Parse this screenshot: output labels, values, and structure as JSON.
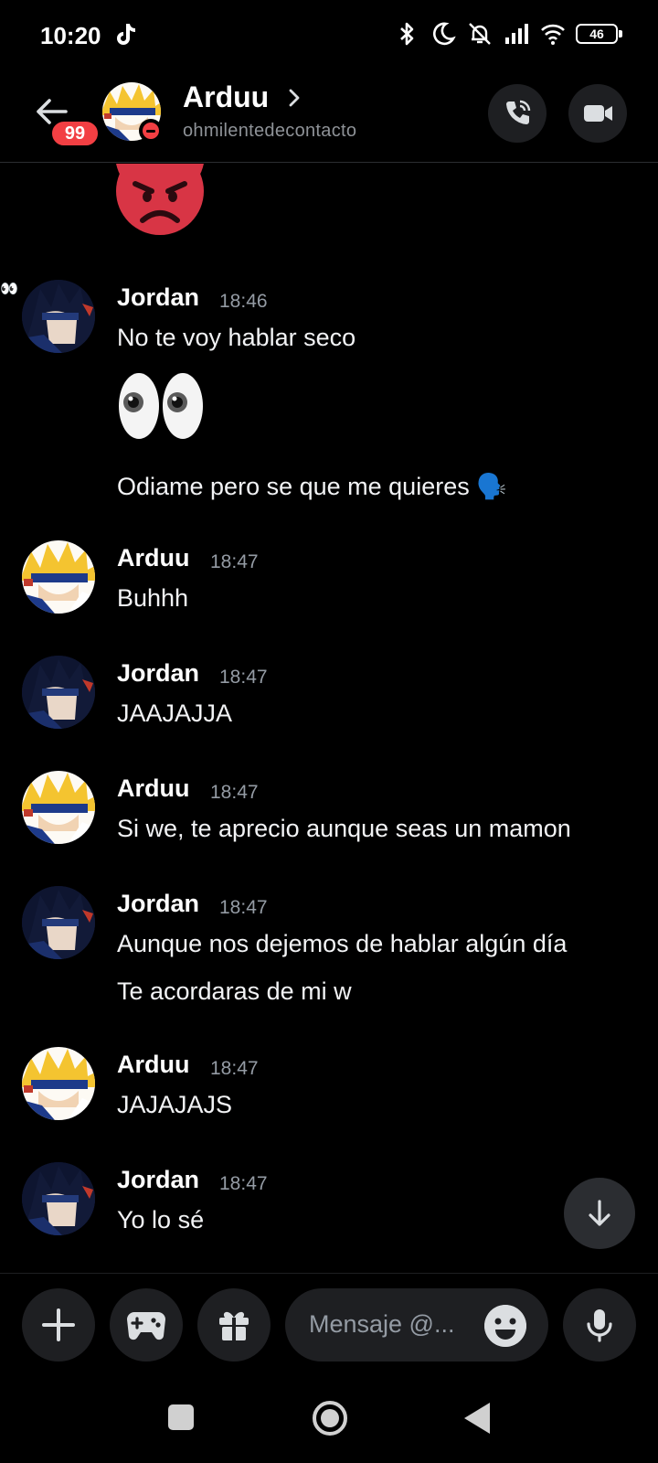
{
  "status_bar": {
    "time": "10:20",
    "battery": "46",
    "icons": [
      "tiktok-icon",
      "bluetooth-icon",
      "moon-icon",
      "mute-icon",
      "signal-icon",
      "wifi-icon",
      "battery-icon"
    ]
  },
  "header": {
    "unread_count": "99",
    "name": "Arduu",
    "username": "ohmilentedecontacto",
    "status": "do-not-disturb",
    "actions": [
      "phone-call-icon",
      "video-camera-icon"
    ]
  },
  "messages": [
    {
      "author": "Jordan",
      "time": "18:46",
      "lines": [
        "No te voy hablar seco",
        "👀",
        "Odiame pero se que me quieres 🗣️"
      ]
    },
    {
      "author": "Arduu",
      "time": "18:47",
      "lines": [
        "Buhhh"
      ]
    },
    {
      "author": "Jordan",
      "time": "18:47",
      "lines": [
        "JAAJAJJA"
      ]
    },
    {
      "author": "Arduu",
      "time": "18:47",
      "lines": [
        "Si we, te aprecio aunque seas un mamon"
      ]
    },
    {
      "author": "Jordan",
      "time": "18:47",
      "lines": [
        "Aunque nos dejemos de hablar algún día",
        "Te acordaras de mi w"
      ]
    },
    {
      "author": "Arduu",
      "time": "18:47",
      "lines": [
        "JAJAJAJS"
      ]
    },
    {
      "author": "Jordan",
      "time": "18:47",
      "lines": [
        "Yo lo sé"
      ]
    }
  ],
  "composer": {
    "placeholder": "Mensaje @...",
    "buttons": [
      "plus-icon",
      "gamepad-icon",
      "gift-icon",
      "emoji-icon",
      "microphone-icon"
    ]
  },
  "colors": {
    "background": "#000000",
    "surface": "#1e1f22",
    "badge_red": "#f23f43",
    "muted_text": "#949ba4"
  }
}
